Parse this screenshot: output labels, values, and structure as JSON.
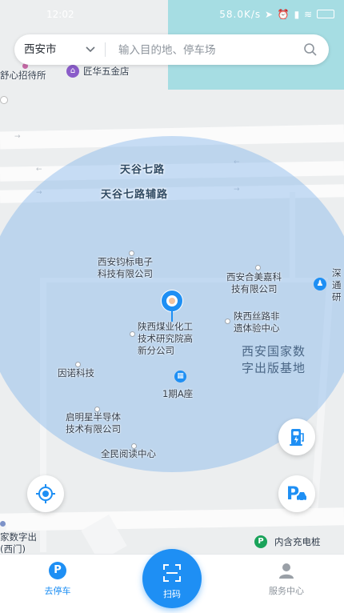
{
  "status": {
    "time": "12:02",
    "indicators": "58.0K/s"
  },
  "search": {
    "city": "西安市",
    "placeholder": "输入目的地、停车场"
  },
  "map": {
    "roads": [
      "天谷七路",
      "天谷七路辅路"
    ],
    "pois": {
      "hostel": "舒心招待所",
      "hardware": "匠华五金店",
      "diaobiao_1": "西安钧标电子",
      "diaobiao_2": "科技有限公司",
      "meijia_1": "西安合美嘉科",
      "meijia_2": "技有限公司",
      "shen_1": "深",
      "shen_2": "通",
      "shen_3": "研",
      "coal_1": "陕西煤业化工",
      "coal_2": "技术研究院高",
      "coal_3": "新分公司",
      "silk_1": "陕西丝路非",
      "silk_2": "遗体验中心",
      "innuo": "因诺科技",
      "phase": "1期A座",
      "qiming_1": "启明星半导体",
      "qiming_2": "技术有限公司",
      "reading": "全民阅读中心",
      "digital_1": "家数字出",
      "digital_2": "(西门)",
      "charging": "内含充电桩"
    },
    "district": [
      "西安国家数",
      "字出版基地"
    ]
  },
  "tabs": {
    "park": "去停车",
    "scan": "扫码",
    "service": "服务中心"
  },
  "colors": {
    "accent": "#1e8ff4",
    "parking_badge": "#1aa35a",
    "water": "#a6dde3",
    "range_circle": "#78afeb"
  }
}
